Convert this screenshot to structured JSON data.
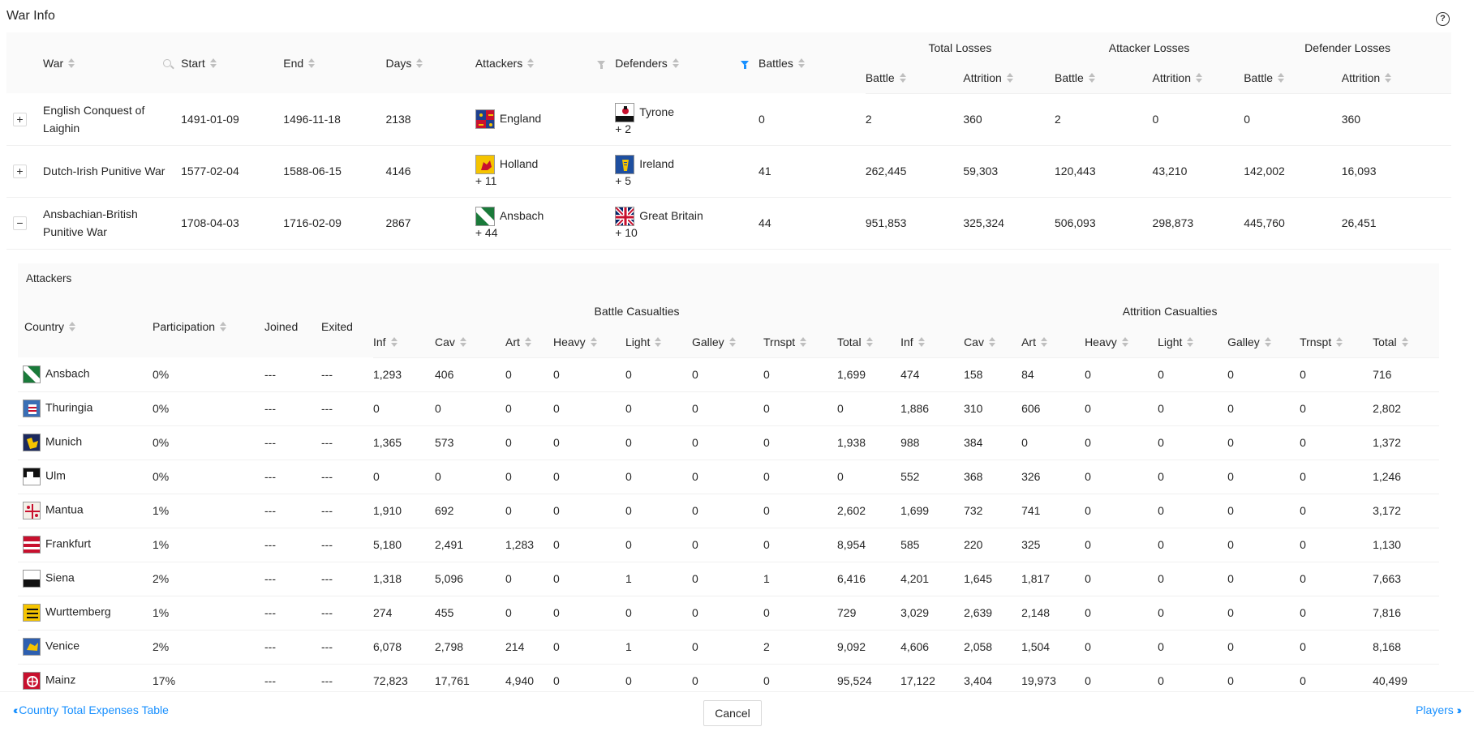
{
  "page": {
    "title": "War Info"
  },
  "main_table": {
    "headers": {
      "war": "War",
      "start": "Start",
      "end": "End",
      "days": "Days",
      "attackers": "Attackers",
      "defenders": "Defenders",
      "battles": "Battles",
      "total_losses": "Total Losses",
      "attacker_losses": "Attacker Losses",
      "defender_losses": "Defender Losses",
      "battle": "Battle",
      "attrition": "Attrition"
    },
    "rows": [
      {
        "expand": "+",
        "war": "English Conquest of Laighin",
        "start": "1491-01-09",
        "end": "1496-11-18",
        "days": "2138",
        "attacker": "England",
        "attacker_more": "",
        "attacker_flag": "england",
        "defender": "Tyrone",
        "defender_more": "+ 2",
        "defender_flag": "tyrone",
        "battles": "0",
        "total_battle": "2",
        "total_attrition": "360",
        "att_battle": "2",
        "att_attrition": "0",
        "def_battle": "0",
        "def_attrition": "360"
      },
      {
        "expand": "+",
        "war": "Dutch-Irish Punitive War",
        "start": "1577-02-04",
        "end": "1588-06-15",
        "days": "4146",
        "attacker": "Holland",
        "attacker_more": "+ 11",
        "attacker_flag": "holland",
        "defender": "Ireland",
        "defender_more": "+ 5",
        "defender_flag": "ireland",
        "battles": "41",
        "total_battle": "262,445",
        "total_attrition": "59,303",
        "att_battle": "120,443",
        "att_attrition": "43,210",
        "def_battle": "142,002",
        "def_attrition": "16,093"
      },
      {
        "expand": "−",
        "war": "Ansbachian-British Punitive War",
        "start": "1708-04-03",
        "end": "1716-02-09",
        "days": "2867",
        "attacker": "Ansbach",
        "attacker_more": "+ 44",
        "attacker_flag": "ansbach",
        "defender": "Great Britain",
        "defender_more": "+ 10",
        "defender_flag": "britain",
        "battles": "44",
        "total_battle": "951,853",
        "total_attrition": "325,324",
        "att_battle": "506,093",
        "att_attrition": "298,873",
        "def_battle": "445,760",
        "def_attrition": "26,451"
      }
    ]
  },
  "sub_table": {
    "card_title": "Attackers",
    "headers": {
      "country": "Country",
      "participation": "Participation",
      "joined": "Joined",
      "exited": "Exited",
      "battle_casualties": "Battle Casualties",
      "attrition_casualties": "Attrition Casualties",
      "inf": "Inf",
      "cav": "Cav",
      "art": "Art",
      "heavy": "Heavy",
      "light": "Light",
      "galley": "Galley",
      "trnspt": "Trnspt",
      "total": "Total"
    },
    "rows": [
      {
        "country": "Ansbach",
        "flag": "ansbach",
        "participation": "0%",
        "joined": "---",
        "exited": "---",
        "b": [
          "1,293",
          "406",
          "0",
          "0",
          "0",
          "0",
          "0",
          "1,699"
        ],
        "a": [
          "474",
          "158",
          "84",
          "0",
          "0",
          "0",
          "0",
          "716"
        ]
      },
      {
        "country": "Thuringia",
        "flag": "thuringia",
        "participation": "0%",
        "joined": "---",
        "exited": "---",
        "b": [
          "0",
          "0",
          "0",
          "0",
          "0",
          "0",
          "0",
          "0"
        ],
        "a": [
          "1,886",
          "310",
          "606",
          "0",
          "0",
          "0",
          "0",
          "2,802"
        ]
      },
      {
        "country": "Munich",
        "flag": "munich",
        "participation": "0%",
        "joined": "---",
        "exited": "---",
        "b": [
          "1,365",
          "573",
          "0",
          "0",
          "0",
          "0",
          "0",
          "1,938"
        ],
        "a": [
          "988",
          "384",
          "0",
          "0",
          "0",
          "0",
          "0",
          "1,372"
        ]
      },
      {
        "country": "Ulm",
        "flag": "ulm",
        "participation": "0%",
        "joined": "---",
        "exited": "---",
        "b": [
          "0",
          "0",
          "0",
          "0",
          "0",
          "0",
          "0",
          "0"
        ],
        "a": [
          "552",
          "368",
          "326",
          "0",
          "0",
          "0",
          "0",
          "1,246"
        ]
      },
      {
        "country": "Mantua",
        "flag": "mantua",
        "participation": "1%",
        "joined": "---",
        "exited": "---",
        "b": [
          "1,910",
          "692",
          "0",
          "0",
          "0",
          "0",
          "0",
          "2,602"
        ],
        "a": [
          "1,699",
          "732",
          "741",
          "0",
          "0",
          "0",
          "0",
          "3,172"
        ]
      },
      {
        "country": "Frankfurt",
        "flag": "frankfurt",
        "participation": "1%",
        "joined": "---",
        "exited": "---",
        "b": [
          "5,180",
          "2,491",
          "1,283",
          "0",
          "0",
          "0",
          "0",
          "8,954"
        ],
        "a": [
          "585",
          "220",
          "325",
          "0",
          "0",
          "0",
          "0",
          "1,130"
        ]
      },
      {
        "country": "Siena",
        "flag": "siena",
        "participation": "2%",
        "joined": "---",
        "exited": "---",
        "b": [
          "1,318",
          "5,096",
          "0",
          "0",
          "1",
          "0",
          "1",
          "6,416"
        ],
        "a": [
          "4,201",
          "1,645",
          "1,817",
          "0",
          "0",
          "0",
          "0",
          "7,663"
        ]
      },
      {
        "country": "Wurttemberg",
        "flag": "wurttemberg",
        "participation": "1%",
        "joined": "---",
        "exited": "---",
        "b": [
          "274",
          "455",
          "0",
          "0",
          "0",
          "0",
          "0",
          "729"
        ],
        "a": [
          "3,029",
          "2,639",
          "2,148",
          "0",
          "0",
          "0",
          "0",
          "7,816"
        ]
      },
      {
        "country": "Venice",
        "flag": "venice",
        "participation": "2%",
        "joined": "---",
        "exited": "---",
        "b": [
          "6,078",
          "2,798",
          "214",
          "0",
          "1",
          "0",
          "2",
          "9,092"
        ],
        "a": [
          "4,606",
          "2,058",
          "1,504",
          "0",
          "0",
          "0",
          "0",
          "8,168"
        ]
      },
      {
        "country": "Mainz",
        "flag": "mainz",
        "participation": "17%",
        "joined": "---",
        "exited": "---",
        "b": [
          "72,823",
          "17,761",
          "4,940",
          "0",
          "0",
          "0",
          "0",
          "95,524"
        ],
        "a": [
          "17,122",
          "3,404",
          "19,973",
          "0",
          "0",
          "0",
          "0",
          "40,499"
        ]
      }
    ]
  },
  "footer": {
    "prev_label": "Country Total Expenses Table",
    "cancel_label": "Cancel",
    "next_label": "Players"
  },
  "colors": {
    "link": "#1890ff",
    "header_bg": "#fafafa",
    "border": "#f0f0f0"
  }
}
